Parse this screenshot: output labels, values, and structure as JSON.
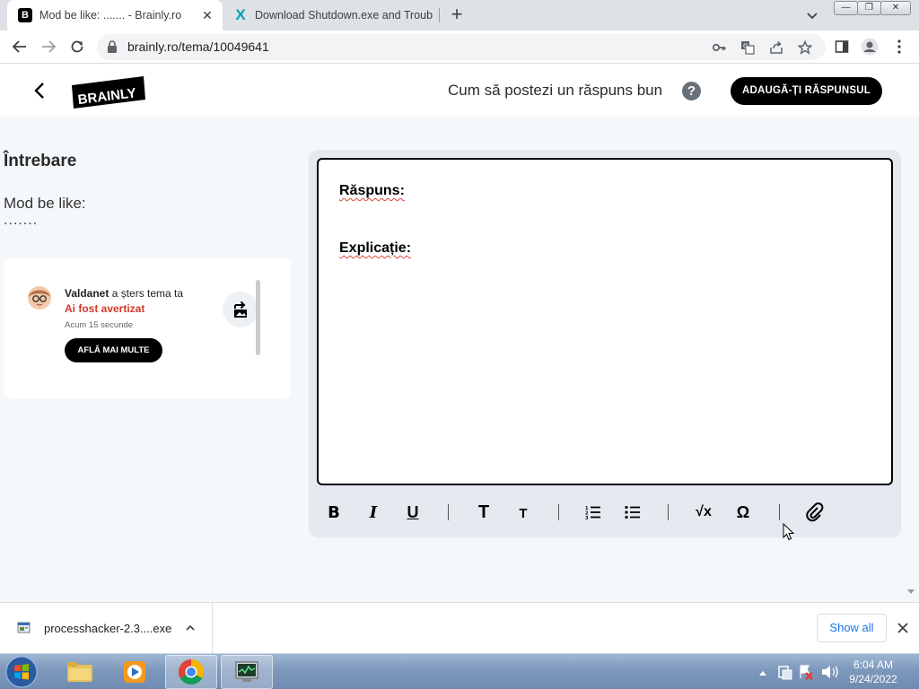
{
  "browser": {
    "tabs": [
      {
        "title": "Mod be like: ....... - Brainly.ro",
        "favicon": "B",
        "active": true
      },
      {
        "title": "Download Shutdown.exe and Troubleshoot",
        "favicon": "X",
        "active": false
      }
    ],
    "url": "brainly.ro/tema/10049641",
    "window_controls": {
      "minimize": "—",
      "maximize": "❐",
      "close": "✕"
    }
  },
  "header": {
    "logo_text": "BRAINLY",
    "how_to_answer": "Cum să postezi un răspuns bun",
    "help_icon": "?",
    "add_answer_button": "ADAUGĂ-ȚI RĂSPUNSUL"
  },
  "question": {
    "heading": "Întrebare",
    "text": "Mod be like:",
    "dots": "......."
  },
  "notification": {
    "user": "Valdanet",
    "action": "a șters tema ta",
    "warning": "Ai fost avertizat",
    "time": "Acum 15 secunde",
    "button": "AFLĂ MAI MULTE"
  },
  "editor": {
    "answer_label": "Răspuns:",
    "explanation_label": "Explicație:",
    "toolbar": {
      "bold": "B",
      "italic": "I",
      "underline": "U",
      "heading_large": "T",
      "heading_small": "T",
      "math": "√x",
      "symbol": "Ω"
    }
  },
  "download": {
    "filename": "processhacker-2.3....exe",
    "show_all": "Show all",
    "close": "✕"
  },
  "taskbar": {
    "time": "6:04 AM",
    "date": "9/24/2022"
  },
  "colors": {
    "brand_black": "#000000",
    "warning_red": "#d1392a",
    "page_bg": "#f5f8fb",
    "link_blue": "#1a73e8"
  }
}
